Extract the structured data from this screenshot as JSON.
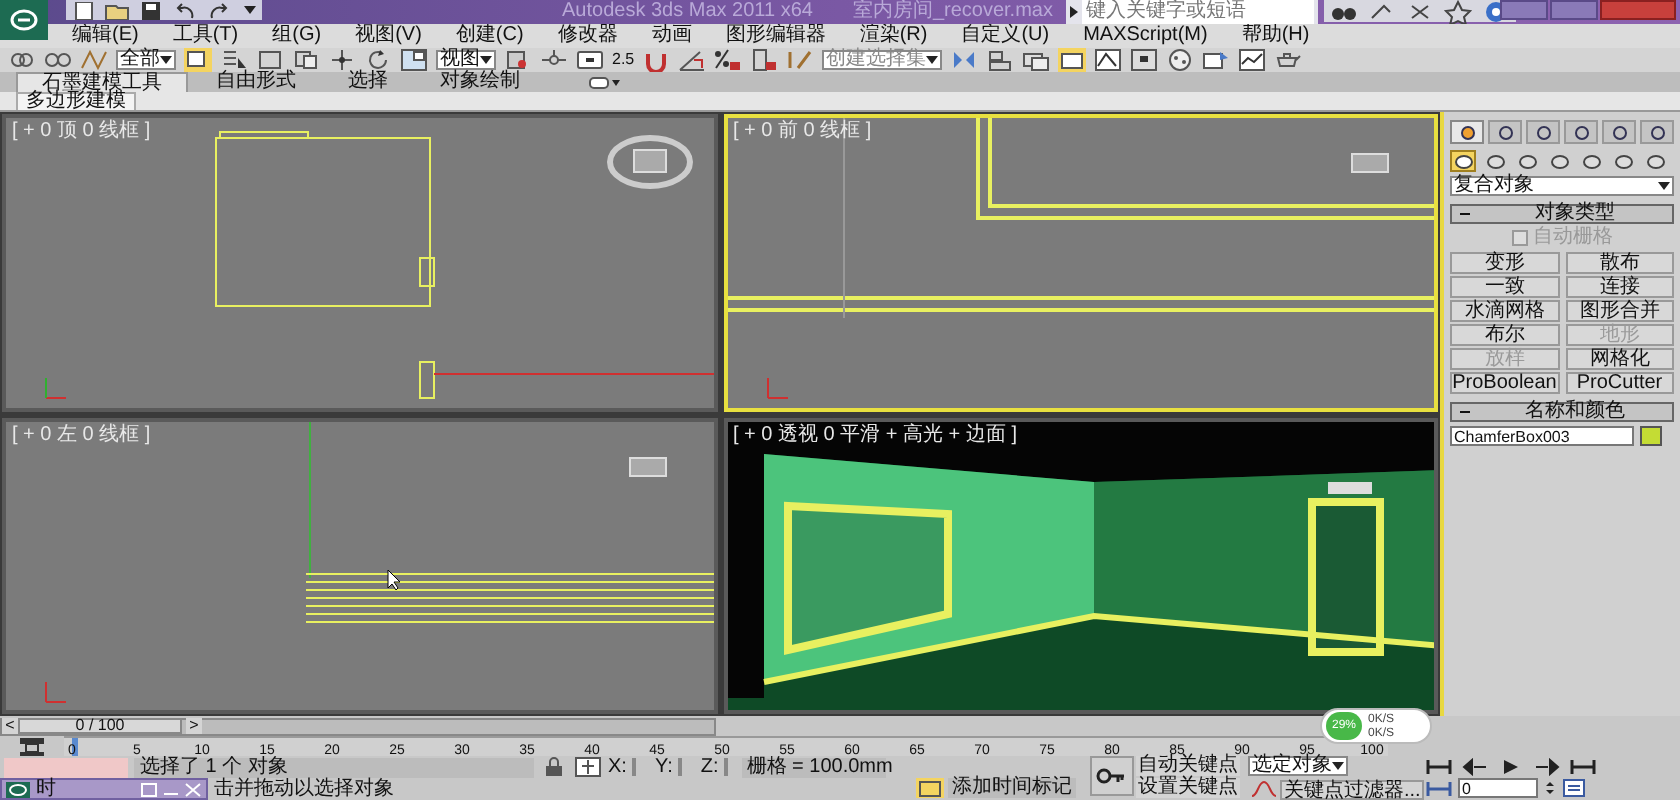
{
  "title_bar": {
    "title": "Autodesk 3ds Max  2011 x64",
    "file": "室内房间_recover.max",
    "search": {
      "placeholder": "键入关键字或短语"
    }
  },
  "menu": [
    "编辑(E)",
    "工具(T)",
    "组(G)",
    "视图(V)",
    "创建(C)",
    "修改器",
    "动画",
    "图形编辑器",
    "渲染(R)",
    "自定义(U)",
    "MAXScript(M)",
    "帮助(H)"
  ],
  "toolbar": {
    "selection_filter": "全部",
    "coordinate_system": "视图",
    "named_selection": {
      "placeholder": "创建选择集"
    },
    "snap_label": "2.5"
  },
  "ribbon_tabs": [
    {
      "label": "石墨建模工具",
      "selected": true
    },
    {
      "label": "自由形式",
      "selected": false
    },
    {
      "label": "选择",
      "selected": false
    },
    {
      "label": "对象绘制",
      "selected": false
    }
  ],
  "ribbon_subtab": "多边形建模",
  "viewports": [
    {
      "kind": "top",
      "label": "[ + 0 顶 0 线框 ]",
      "active": false
    },
    {
      "kind": "front",
      "label": "[ + 0 前 0 线框 ]",
      "active": true
    },
    {
      "kind": "left",
      "label": "[ + 0 左 0 线框 ]",
      "active": false
    },
    {
      "kind": "perspective",
      "label": "[ + 0 透视 0 平滑 + 高光 + 边面 ]",
      "active": false
    }
  ],
  "net_monitor": {
    "percent": "29%",
    "rates": [
      "0K/S",
      "0K/S"
    ]
  },
  "command_panel": {
    "category": "复合对象",
    "rollouts": [
      {
        "kind": "buttons",
        "title": "对象类型",
        "autogrid": {
          "label": "自动栅格",
          "checked": false,
          "disabled": true
        },
        "buttons": [
          {
            "label": "变形",
            "disabled": false
          },
          {
            "label": "散布",
            "disabled": false
          },
          {
            "label": "一致",
            "disabled": false
          },
          {
            "label": "连接",
            "disabled": false
          },
          {
            "label": "水滴网格",
            "disabled": false
          },
          {
            "label": "图形合并",
            "disabled": false
          },
          {
            "label": "布尔",
            "disabled": false
          },
          {
            "label": "地形",
            "disabled": true
          },
          {
            "label": "放样",
            "disabled": true
          },
          {
            "label": "网格化",
            "disabled": false
          },
          {
            "label": "ProBoolean",
            "disabled": false
          },
          {
            "label": "ProCutter",
            "disabled": false
          }
        ]
      },
      {
        "kind": "name",
        "title": "名称和颜色",
        "name": "ChamferBox003",
        "color": "#c4dc34"
      }
    ]
  },
  "time_slider": {
    "prev": "<",
    "position": "0 / 100",
    "next": ">",
    "level": 0
  },
  "track_ticks": [
    "0",
    "5",
    "10",
    "15",
    "20",
    "25",
    "30",
    "35",
    "40",
    "45",
    "50",
    "55",
    "60",
    "65",
    "70",
    "75",
    "80",
    "85",
    "90",
    "95",
    "100"
  ],
  "mini_window": {
    "title": "时"
  },
  "status": {
    "selection": "选择了 1 个 对象",
    "prompt": "击并拖动以选择对象",
    "x_label": "X:",
    "y_label": "Y:",
    "z_label": "Z:",
    "grid": "栅格 = 100.0mm",
    "add_time_tag": "添加时间标记",
    "auto_key": "自动关键点",
    "set_key": "设置关键点",
    "key_mode": "选定对象",
    "key_filters": "关键点过滤器...",
    "frame": "0"
  }
}
